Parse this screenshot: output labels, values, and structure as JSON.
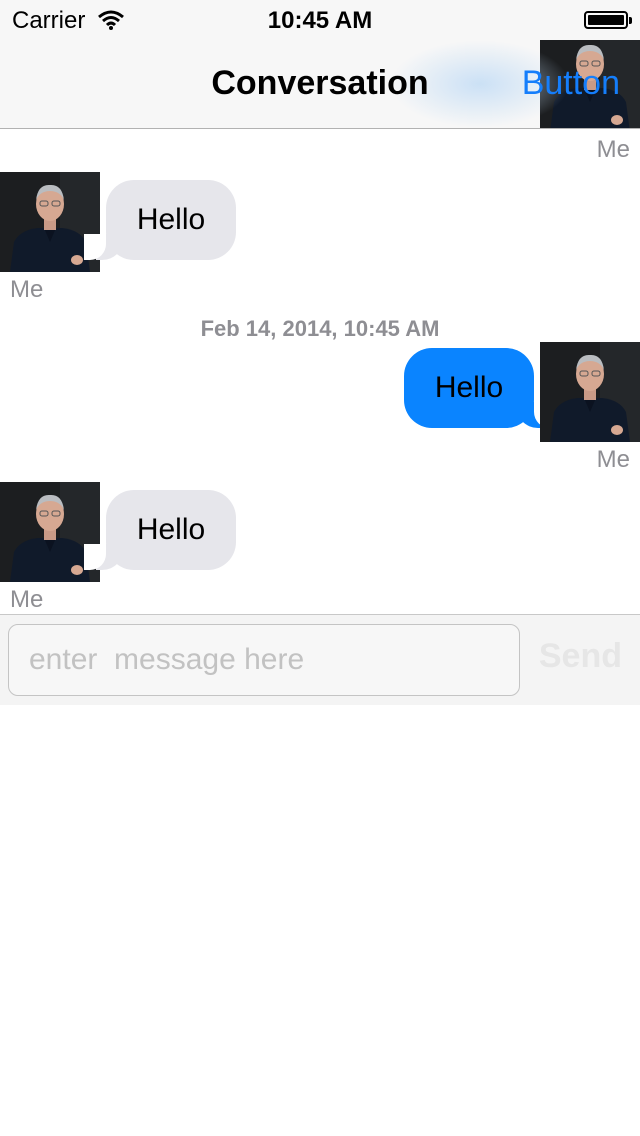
{
  "status_bar": {
    "carrier": "Carrier",
    "time": "10:45 AM"
  },
  "nav": {
    "title": "Conversation",
    "right_button": "Button"
  },
  "messages": [
    {
      "direction": "incoming",
      "text": "Hello",
      "sender": "Me"
    },
    {
      "direction": "outgoing",
      "text": "Hello",
      "sender": "Me"
    },
    {
      "direction": "incoming",
      "text": "Hello",
      "sender": "Me"
    }
  ],
  "top_partial_sender": "Me",
  "timestamp": "Feb 14, 2014, 10:45 AM",
  "composer": {
    "placeholder": "enter  message here",
    "send_label": "Send"
  },
  "colors": {
    "accent": "#157efb",
    "outgoing_bubble": "#0a84ff",
    "incoming_bubble": "#e6e6eb",
    "meta_text": "#8e8e93"
  },
  "icons": [
    "wifi-icon",
    "battery-icon",
    "avatar"
  ]
}
